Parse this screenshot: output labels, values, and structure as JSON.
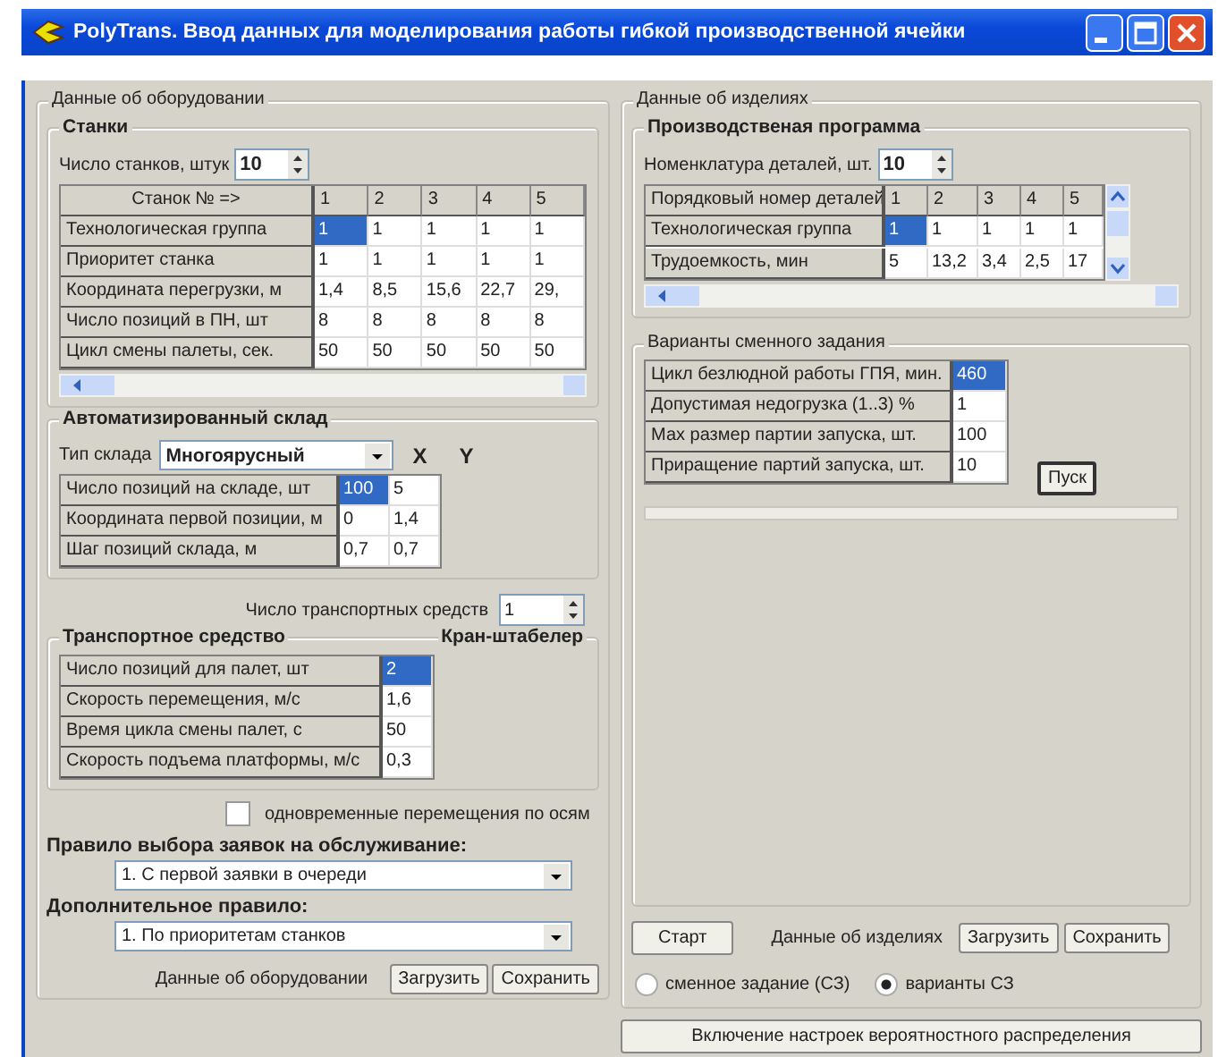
{
  "window": {
    "title": "PolyTrans.  Ввод данных для моделирования работы гибкой производственной ячейки"
  },
  "equipment": {
    "title": "Данные об оборудовании",
    "machines": {
      "title": "Станки",
      "count_label": "Число станков, штук",
      "count": "10",
      "corner": "Станок № =>",
      "columns": [
        "1",
        "2",
        "3",
        "4",
        "5"
      ],
      "rows": [
        {
          "label": "Технологическая группа",
          "cells": [
            {
              "v": "1",
              "selected": true
            },
            {
              "v": "1",
              "selected": false
            },
            {
              "v": "1",
              "selected": false
            },
            {
              "v": "1",
              "selected": false
            },
            {
              "v": "1",
              "selected": false
            }
          ]
        },
        {
          "label": "Приоритет станка",
          "cells": [
            {
              "v": "1",
              "selected": false
            },
            {
              "v": "1",
              "selected": false
            },
            {
              "v": "1",
              "selected": false
            },
            {
              "v": "1",
              "selected": false
            },
            {
              "v": "1",
              "selected": false
            }
          ]
        },
        {
          "label": "Координата перегрузки, м",
          "cells": [
            {
              "v": "1,4",
              "selected": false
            },
            {
              "v": "8,5",
              "selected": false
            },
            {
              "v": "15,6",
              "selected": false
            },
            {
              "v": "22,7",
              "selected": false
            },
            {
              "v": "29,",
              "selected": false
            }
          ]
        },
        {
          "label": "Число позиций в ПН, шт",
          "cells": [
            {
              "v": "8",
              "selected": false
            },
            {
              "v": "8",
              "selected": false
            },
            {
              "v": "8",
              "selected": false
            },
            {
              "v": "8",
              "selected": false
            },
            {
              "v": "8",
              "selected": false
            }
          ]
        },
        {
          "label": "Цикл смены палеты, сек.",
          "cells": [
            {
              "v": "50",
              "selected": false
            },
            {
              "v": "50",
              "selected": false
            },
            {
              "v": "50",
              "selected": false
            },
            {
              "v": "50",
              "selected": false
            },
            {
              "v": "50",
              "selected": false
            }
          ]
        }
      ]
    },
    "warehouse": {
      "title": "Автоматизированный склад",
      "type_label": "Тип склада",
      "type": "Многоярусный",
      "columns": [
        "X",
        "Y"
      ],
      "rows": [
        {
          "label": "Число позиций на складе, шт",
          "cells": [
            {
              "v": "100",
              "selected": true
            },
            {
              "v": "5",
              "selected": false
            }
          ]
        },
        {
          "label": "Координата первой позиции, м",
          "cells": [
            {
              "v": "0",
              "selected": false
            },
            {
              "v": "1,4",
              "selected": false
            }
          ]
        },
        {
          "label": "Шаг позиций склада, м",
          "cells": [
            {
              "v": "0,7",
              "selected": false
            },
            {
              "v": "0,7",
              "selected": false
            }
          ]
        }
      ]
    },
    "transport_count": {
      "label": "Число транспортных средств",
      "value": "1"
    },
    "vehicle": {
      "title": "Транспортное средство",
      "type": "Кран-штабелер",
      "rows": [
        {
          "label": "Число позиций для палет, шт",
          "cells": [
            {
              "v": "2",
              "selected": true
            }
          ]
        },
        {
          "label": "Скорость перемещения, м/с",
          "cells": [
            {
              "v": "1,6",
              "selected": false
            }
          ]
        },
        {
          "label": "Время цикла смены палет, с",
          "cells": [
            {
              "v": "50",
              "selected": false
            }
          ]
        },
        {
          "label": "Скорость подъема платформы, м/с",
          "cells": [
            {
              "v": "0,3",
              "selected": false
            }
          ]
        }
      ]
    },
    "simultaneous": {
      "label": "одновременные перемещения по осям",
      "checked": false
    },
    "rules": [
      {
        "label": "Правило выбора заявок на обслуживание:",
        "value": "1. С первой заявки в очереди"
      },
      {
        "label": "Дополнительное правило:",
        "value": "1. По приоритетам станков"
      }
    ],
    "footer": {
      "label": "Данные об оборудовании",
      "buttons": [
        "Загрузить",
        "Сохранить"
      ]
    }
  },
  "products": {
    "title": "Данные об изделиях",
    "program": {
      "title": "Производственая программа",
      "count_label": "Номенклатура деталей, шт.",
      "count": "10",
      "corner": "Порядковый номер деталей",
      "columns": [
        "1",
        "2",
        "3",
        "4",
        "5"
      ],
      "rows": [
        {
          "label": "Технологическая группа",
          "cells": [
            {
              "v": "1",
              "selected": true
            },
            {
              "v": "1",
              "selected": false
            },
            {
              "v": "1",
              "selected": false
            },
            {
              "v": "1",
              "selected": false
            },
            {
              "v": "1",
              "selected": false
            }
          ]
        },
        {
          "label": "Трудоемкость, мин",
          "cells": [
            {
              "v": "5",
              "selected": false
            },
            {
              "v": "13,2",
              "selected": false
            },
            {
              "v": "3,4",
              "selected": false
            },
            {
              "v": "2,5",
              "selected": false
            },
            {
              "v": "17",
              "selected": false
            }
          ]
        }
      ]
    },
    "variants": {
      "title": "Варианты сменного задания",
      "button": "Пуск",
      "rows": [
        {
          "label": "Цикл безлюдной работы ГПЯ, мин.",
          "cells": [
            {
              "v": "460",
              "selected": true
            }
          ]
        },
        {
          "label": "Допустимая недогрузка (1..3) %",
          "cells": [
            {
              "v": "1",
              "selected": false
            }
          ]
        },
        {
          "label": "Мах размер партии запуска, шт.",
          "cells": [
            {
              "v": "100",
              "selected": false
            }
          ]
        },
        {
          "label": "Приращение партий запуска, шт.",
          "cells": [
            {
              "v": "10",
              "selected": false
            }
          ]
        }
      ]
    },
    "footer": {
      "start": "Старт",
      "label": "Данные об изделиях",
      "buttons": [
        "Загрузить",
        "Сохранить"
      ]
    },
    "modes": [
      {
        "label": "сменное задание (СЗ)",
        "selected": false
      },
      {
        "label": "варианты СЗ",
        "selected": true
      }
    ],
    "bottom_button": "Включение настроек вероятностного распределения"
  }
}
